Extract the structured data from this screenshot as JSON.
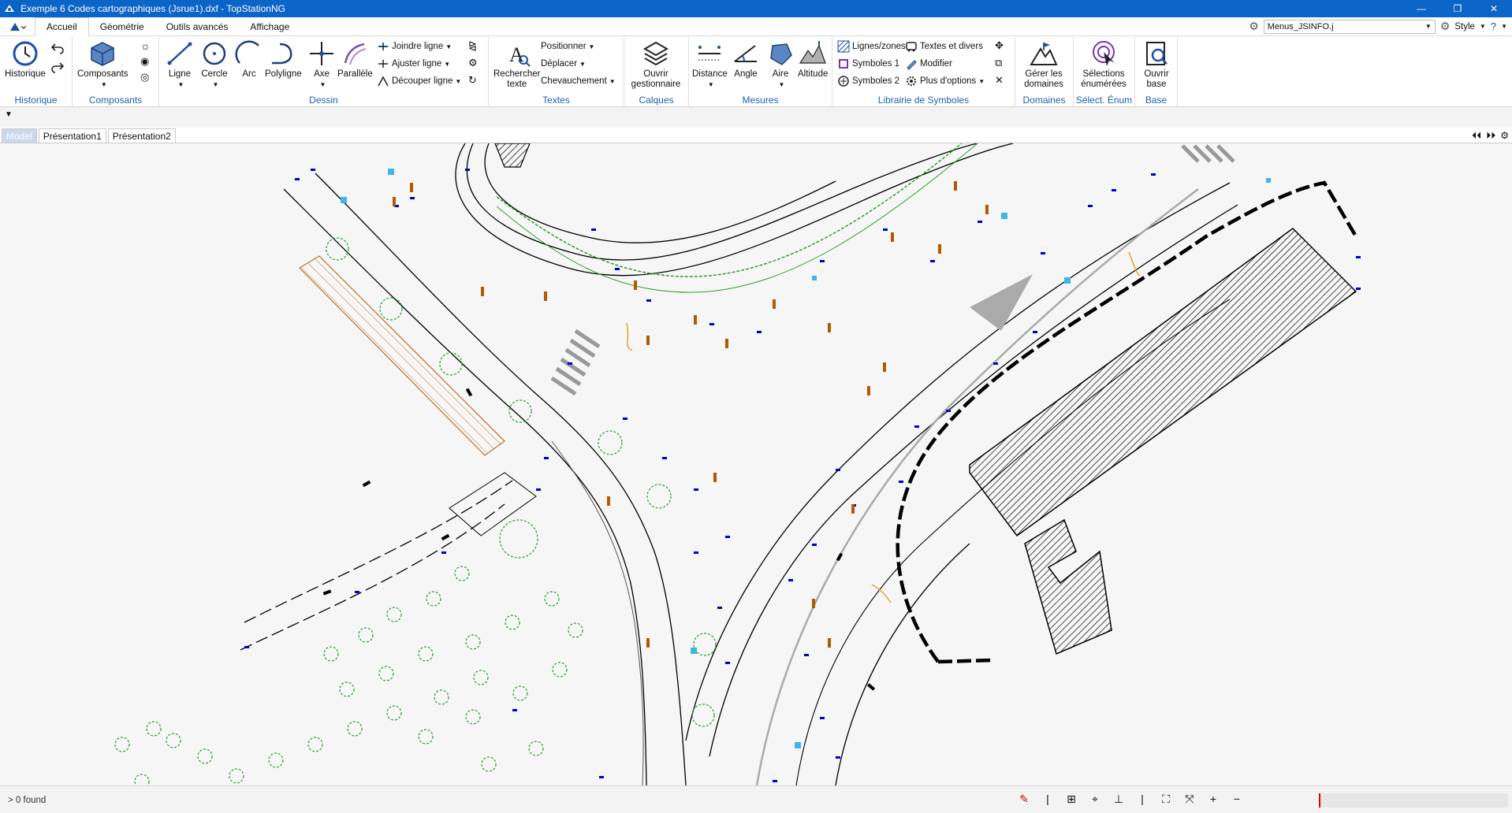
{
  "window": {
    "title": "Exemple 6 Codes cartographiques (Jsrue1).dxf - TopStationNG",
    "minimize": "—",
    "maximize": "❐",
    "close": "✕"
  },
  "menu": {
    "tabs": [
      "Accueil",
      "Géométrie",
      "Outils avancés",
      "Affichage"
    ],
    "active_tab": "Accueil",
    "combo_value": "Menus_JSINFO.j",
    "style_label": "Style"
  },
  "ribbon": {
    "historique": {
      "btn": "Historique",
      "group": "Historique"
    },
    "composants": {
      "btn": "Composants",
      "group": "Composants"
    },
    "dessin": {
      "group": "Dessin",
      "ligne": "Ligne",
      "cercle": "Cercle",
      "arc": "Arc",
      "polyligne": "Polyligne",
      "axe": "Axe",
      "parallele": "Parallèle",
      "joindre": "Joindre ligne",
      "ajuster": "Ajuster ligne",
      "decouper": "Découper ligne"
    },
    "textes": {
      "group": "Textes",
      "rechercher": "Rechercher\ntexte",
      "positionner": "Positionner",
      "deplacer": "Déplacer",
      "chevauchement": "Chevauchement"
    },
    "calques": {
      "group": "Calques",
      "btn": "Ouvrir\ngestionnaire"
    },
    "mesures": {
      "group": "Mesures",
      "distance": "Distance",
      "angle": "Angle",
      "aire": "Aire",
      "altitude": "Altitude"
    },
    "librairie": {
      "group": "Librairie de Symboles",
      "lignes_zones": "Lignes/zones",
      "symboles1": "Symboles 1",
      "symboles2": "Symboles 2",
      "textes_divers": "Textes et divers",
      "modifier": "Modifier",
      "plus_options": "Plus d'options"
    },
    "domaines": {
      "group": "Domaines",
      "btn": "Gérer les\ndomaines"
    },
    "select_enum": {
      "group": "Sélect. Énum",
      "btn": "Sélections\nénumérées"
    },
    "base": {
      "group": "Base",
      "btn": "Ouvrir\nbase"
    }
  },
  "doc_tabs": [
    "Model",
    "Présentation1",
    "Présentation2"
  ],
  "status": {
    "message": "> 0 found"
  },
  "colors": {
    "titlebar": "#0b64c8",
    "group_label": "#1c5fb8",
    "road_line": "#000000",
    "vegetation": "#2ca02c",
    "point_marker": "#0000cc",
    "elevation_label": "#b35900",
    "building_hatch": "#000000"
  }
}
